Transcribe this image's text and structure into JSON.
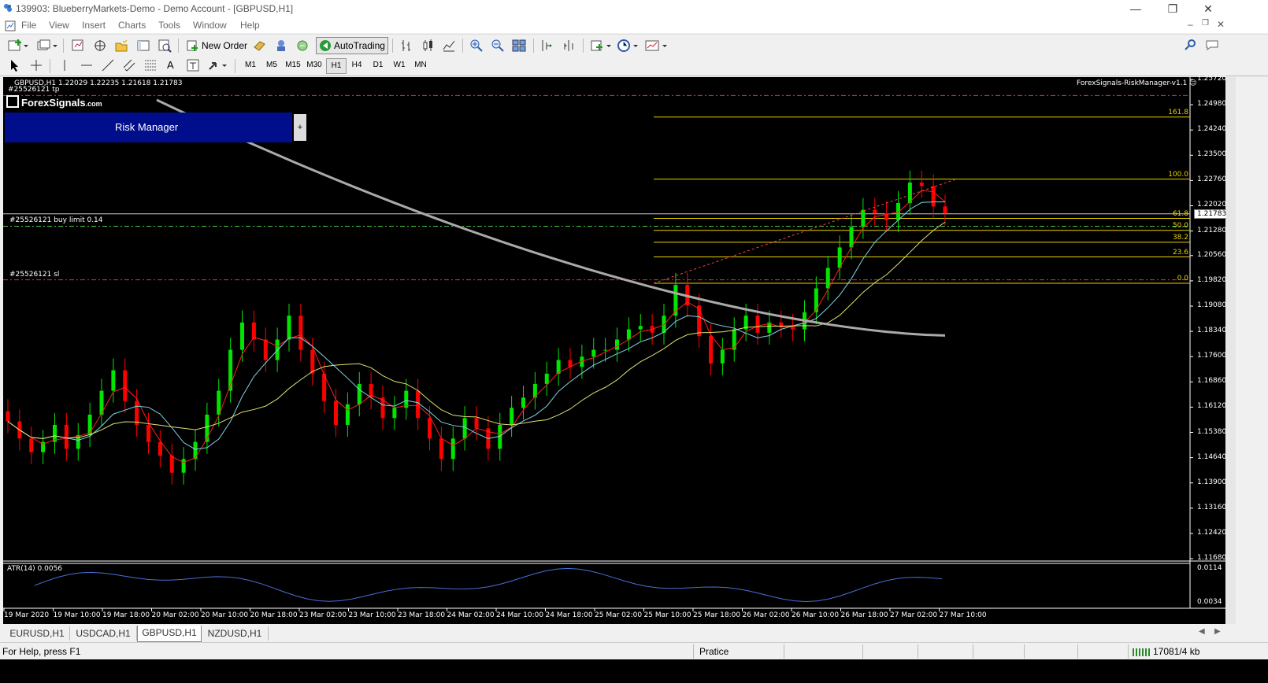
{
  "window": {
    "title": "139903: BlueberryMarkets-Demo - Demo Account - [GBPUSD,H1]",
    "minimize": "—",
    "restore": "❐",
    "close": "✕"
  },
  "menu": [
    "File",
    "View",
    "Insert",
    "Charts",
    "Tools",
    "Window",
    "Help"
  ],
  "toolbar": {
    "new_order": "New Order",
    "auto_trading": "AutoTrading",
    "draw_text": "A"
  },
  "timeframes": [
    "M1",
    "M5",
    "M15",
    "M30",
    "H1",
    "H4",
    "D1",
    "W1",
    "MN"
  ],
  "active_timeframe": "H1",
  "chart": {
    "header": "GBPUSD,H1  1.22029 1.22235 1.21618 1.21783",
    "brand": "ForexSignals",
    "brand_suffix": ".com",
    "ea_name": "ForexSignals-RiskManager-v1.1 ☺",
    "risk_manager": "Risk Manager",
    "risk_btn": "+",
    "order_tp": "#25526121 tp",
    "order_buy": "#25526121 buy limit 0.14",
    "order_sl": "#25526121 sl",
    "current_price": "1.21783",
    "fib_labels": [
      "161.8",
      "100.0",
      "61.8",
      "50.0",
      "38.2",
      "23.6",
      "0.0"
    ],
    "indicator": "ATR(14) 0.0056",
    "ind_ticks": [
      "0.0114",
      "0.0034"
    ]
  },
  "chart_data": {
    "type": "candlestick",
    "symbol": "GBPUSD",
    "timeframe": "H1",
    "ohlc_last": {
      "open": 1.22029,
      "high": 1.22235,
      "low": 1.21618,
      "close": 1.21783
    },
    "price_ticks": [
      "1.25720",
      "1.24980",
      "1.24240",
      "1.23500",
      "1.22760",
      "1.22020",
      "1.21280",
      "1.20560",
      "1.19820",
      "1.19080",
      "1.18340",
      "1.17600",
      "1.16860",
      "1.16120",
      "1.15380",
      "1.14640",
      "1.13900",
      "1.13160",
      "1.12420",
      "1.11680"
    ],
    "time_ticks": [
      "19 Mar 2020",
      "19 Mar 10:00",
      "19 Mar 18:00",
      "20 Mar 02:00",
      "20 Mar 10:00",
      "20 Mar 18:00",
      "23 Mar 02:00",
      "23 Mar 10:00",
      "23 Mar 18:00",
      "24 Mar 02:00",
      "24 Mar 10:00",
      "24 Mar 18:00",
      "25 Mar 02:00",
      "25 Mar 10:00",
      "25 Mar 18:00",
      "26 Mar 02:00",
      "26 Mar 10:00",
      "26 Mar 18:00",
      "27 Mar 02:00",
      "27 Mar 10:00"
    ],
    "ylim": [
      1.1168,
      1.2572
    ],
    "closes": [
      1.157,
      1.152,
      1.148,
      1.151,
      1.156,
      1.149,
      1.153,
      1.159,
      1.166,
      1.172,
      1.163,
      1.156,
      1.151,
      1.147,
      1.142,
      1.146,
      1.151,
      1.159,
      1.166,
      1.178,
      1.186,
      1.181,
      1.175,
      1.181,
      1.188,
      1.178,
      1.171,
      1.163,
      1.156,
      1.162,
      1.168,
      1.164,
      1.158,
      1.161,
      1.166,
      1.158,
      1.152,
      1.146,
      1.152,
      1.158,
      1.155,
      1.149,
      1.156,
      1.161,
      1.164,
      1.168,
      1.171,
      1.175,
      1.173,
      1.176,
      1.178,
      1.178,
      1.181,
      1.184,
      1.185,
      1.183,
      1.188,
      1.197,
      1.191,
      1.182,
      1.174,
      1.178,
      1.184,
      1.188,
      1.183,
      1.186,
      1.185,
      1.184,
      1.189,
      1.196,
      1.202,
      1.208,
      1.214,
      1.219,
      1.218,
      1.216,
      1.221,
      1.227,
      1.226,
      1.22,
      1.218
    ],
    "fib_levels": {
      "161.8": 1.2462,
      "100.0": 1.228,
      "61.8": 1.2165,
      "50.0": 1.213,
      "38.2": 1.2095,
      "23.6": 1.2052,
      "0.0": 1.1975
    },
    "orders": {
      "tp": 1.2525,
      "buy_limit": 1.2142,
      "sl": 1.1985
    },
    "atr": {
      "period": 14,
      "value": 0.0056,
      "ylim": [
        0.0034,
        0.0114
      ]
    }
  },
  "tabs": [
    "EURUSD,H1",
    "USDCAD,H1",
    "GBPUSD,H1",
    "NZDUSD,H1"
  ],
  "active_tab": "GBPUSD,H1",
  "status": {
    "help": "For Help, press F1",
    "profile": "Pratice",
    "traffic": "17081/4 kb"
  },
  "colors": {
    "bull": "#00e600",
    "bear": "#ff0000",
    "ma_fast": "#ff2020",
    "ma_mid": "#7fd4e6",
    "ma_slow": "#e0e070",
    "ma_long": "#aaaaaa",
    "fib": "#e7d200",
    "atr": "#4a6fd8",
    "risk_panel": "#000e8c"
  }
}
